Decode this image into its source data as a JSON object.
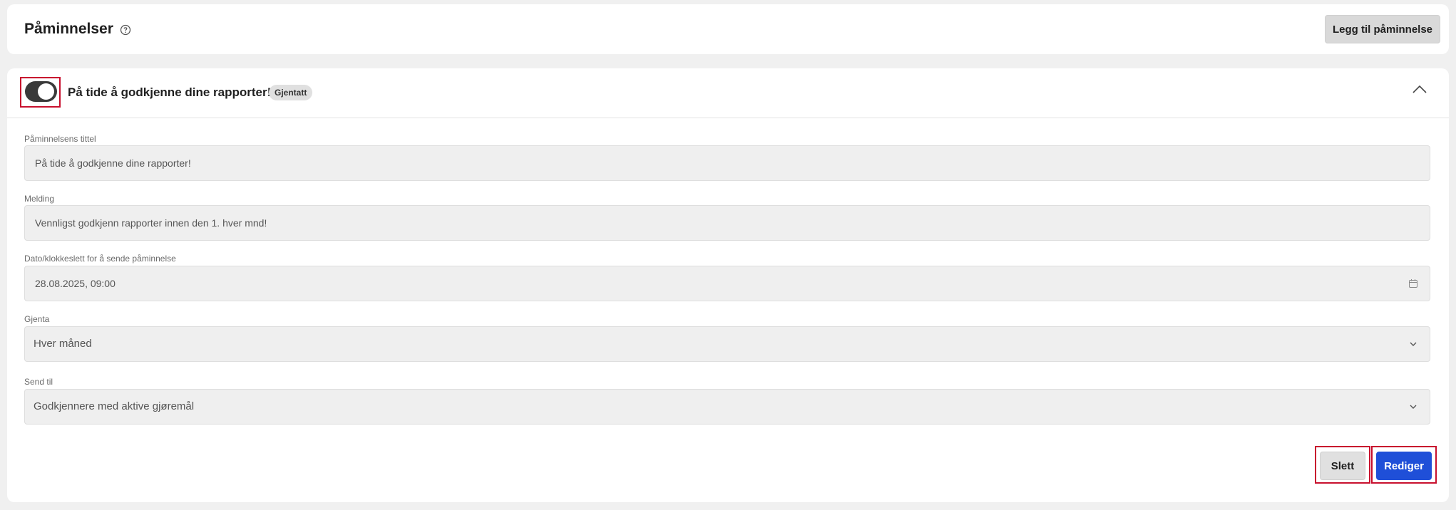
{
  "header": {
    "title": "Påminnelser",
    "add_button": "Legg til påminnelse"
  },
  "reminder": {
    "enabled": true,
    "title": "På tide å godkjenne dine rapporter!",
    "badge": "Gjentatt",
    "fields": {
      "title_label": "Påminnelsens tittel",
      "title_value": "På tide å godkjenne dine rapporter!",
      "message_label": "Melding",
      "message_value": "Vennligst godkjenn rapporter innen den 1. hver mnd!",
      "datetime_label": "Dato/klokkeslett for å sende påminnelse",
      "datetime_value": "28.08.2025, 09:00",
      "repeat_label": "Gjenta",
      "repeat_value": "Hver måned",
      "send_to_label": "Send til",
      "send_to_value": "Godkjennere med aktive gjøremål"
    },
    "actions": {
      "delete": "Slett",
      "edit": "Rediger"
    }
  },
  "icons": {
    "help": "help-circle-icon",
    "collapse": "chevron-up-icon",
    "calendar": "calendar-icon",
    "dropdown": "chevron-down-icon"
  },
  "colors": {
    "primary": "#1f4fd8",
    "toggle_on": "#3a3a3a",
    "highlight": "#c8102e"
  }
}
